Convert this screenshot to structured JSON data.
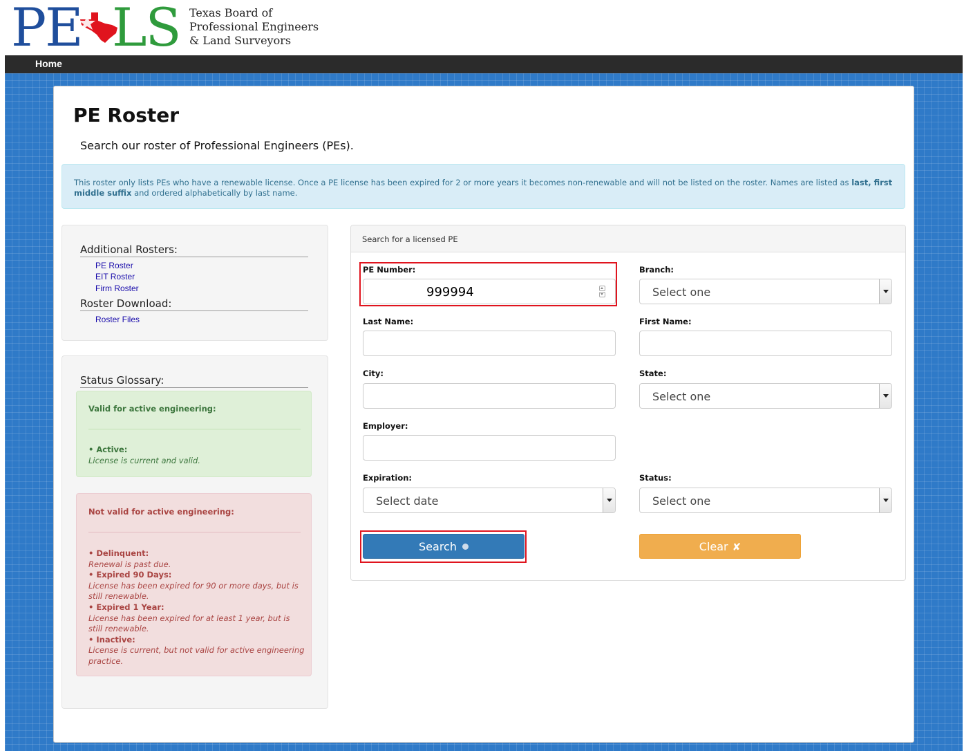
{
  "header": {
    "logo": {
      "pe": "PE",
      "ls": "LS",
      "line1": "Texas Board of",
      "line2": "Professional Engineers",
      "line3": "& Land Surveyors"
    },
    "nav_home": "Home"
  },
  "page": {
    "title": "PE Roster",
    "subtitle": "Search our roster of Professional Engineers (PEs).",
    "info_text": "This roster only lists PEs who have a renewable license. Once a PE license has been expired for 2 or more years it becomes non-renewable and will not be listed on the roster. Names are listed as ",
    "info_bold": "last, first middle suffix",
    "info_tail": " and ordered alphabetically by last name."
  },
  "sidebar": {
    "additional_heading": "Additional Rosters:",
    "rosters": [
      "PE Roster",
      "EIT Roster",
      "Firm Roster"
    ],
    "download_heading": "Roster Download:",
    "download_link": "Roster Files",
    "glossary_heading": "Status Glossary:",
    "valid": {
      "title": "Valid for active engineering:",
      "items": [
        {
          "term": "• Active:",
          "desc": "License is current and valid."
        }
      ]
    },
    "invalid": {
      "title": "Not valid for active engineering:",
      "items": [
        {
          "term": "• Delinquent:",
          "desc": "Renewal is past due."
        },
        {
          "term": "• Expired 90 Days:",
          "desc": "License has been expired for 90 or more days, but is still renewable."
        },
        {
          "term": "• Expired 1 Year:",
          "desc": "License has been expired for at least 1 year, but is still renewable."
        },
        {
          "term": "• Inactive:",
          "desc": "License is current, but not valid for active engineering practice."
        }
      ]
    }
  },
  "form": {
    "heading": "Search for a licensed PE",
    "pe_number_label": "PE Number:",
    "pe_number_value": "999994",
    "branch_label": "Branch:",
    "branch_value": "Select one",
    "last_name_label": "Last Name:",
    "first_name_label": "First Name:",
    "city_label": "City:",
    "state_label": "State:",
    "state_value": "Select one",
    "employer_label": "Employer:",
    "expiration_label": "Expiration:",
    "expiration_value": "Select date",
    "status_label": "Status:",
    "status_value": "Select one",
    "search_label": "Search",
    "clear_label": "Clear"
  },
  "colors": {
    "brand_blue": "#1f4e9c",
    "brand_green": "#2f9b3c",
    "star_red": "#e0141e",
    "search_button": "#337ab7",
    "clear_button": "#f0ad4e",
    "highlight": "#e0141e"
  },
  "icons": {
    "logo_star": "texas-star-icon",
    "search": "search-icon",
    "clear": "x-icon",
    "select_caret": "caret-down-icon"
  }
}
